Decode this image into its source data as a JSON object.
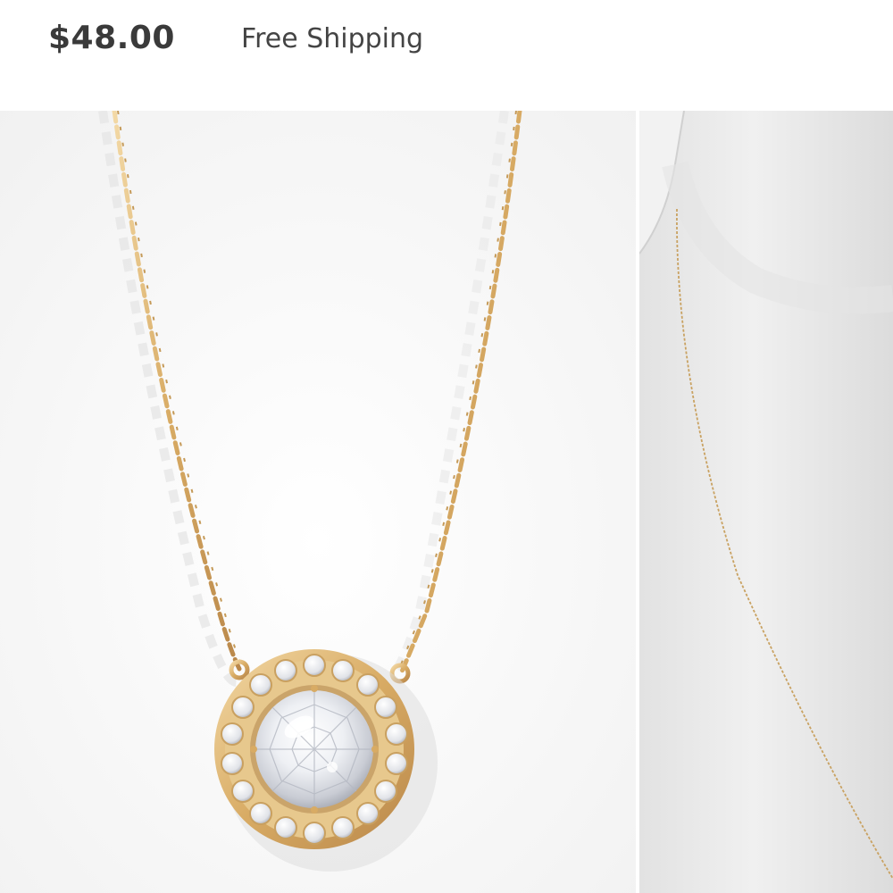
{
  "product": {
    "price": "$48.00",
    "shipping": "Free Shipping"
  },
  "gallery": {
    "images": [
      {
        "subject": "gold halo crystal pendant necklace"
      },
      {
        "subject": "necklace on white bust form"
      }
    ]
  },
  "colors": {
    "price_text": "#3a3a3a",
    "gold": "#d8b070",
    "background": "#ffffff"
  }
}
